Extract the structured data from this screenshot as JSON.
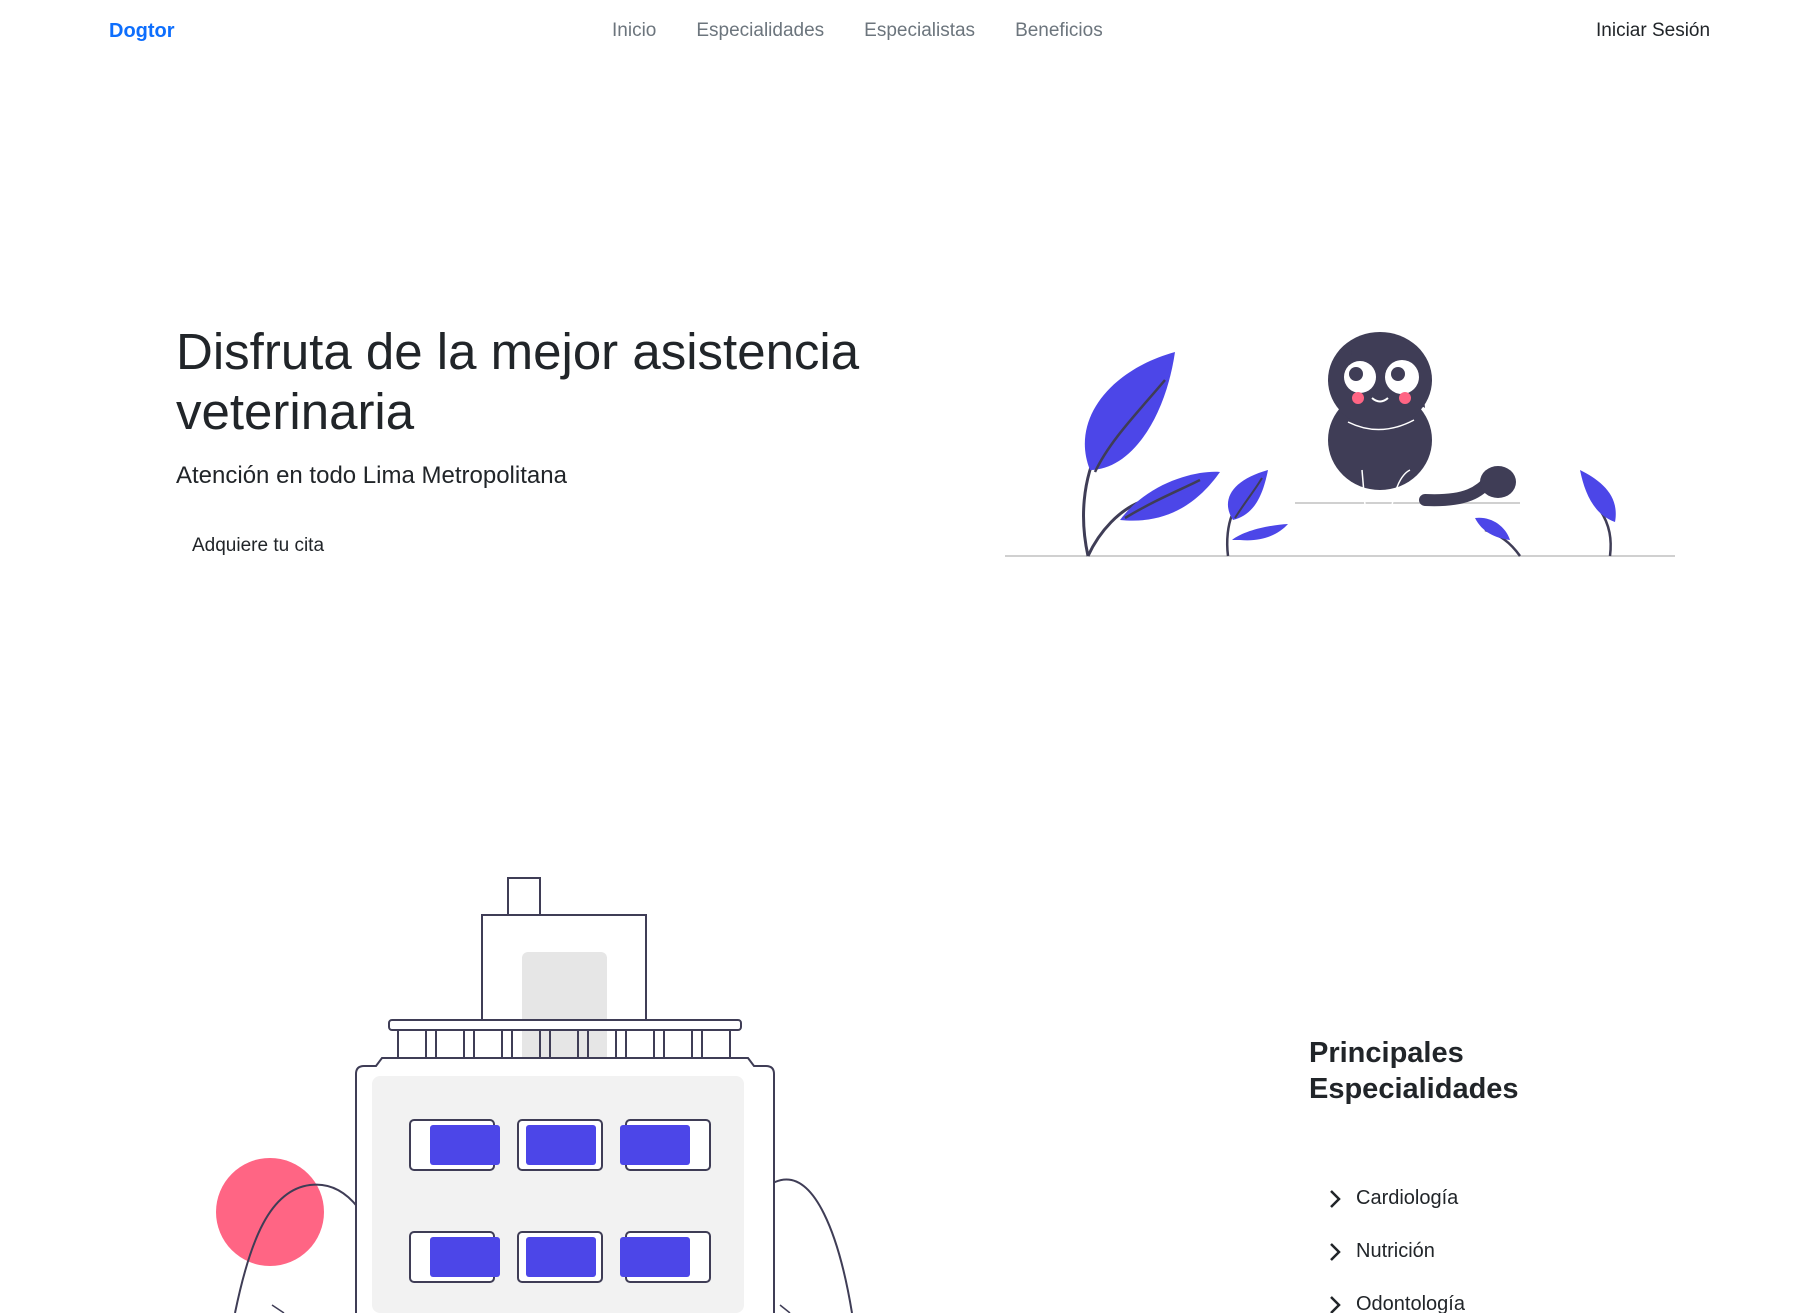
{
  "navbar": {
    "brand": "Dogtor",
    "links": [
      "Inicio",
      "Especialidades",
      "Especialistas",
      "Beneficios"
    ],
    "login": "Iniciar Sesión"
  },
  "hero": {
    "title": "Disfruta de la mejor asistencia veterinaria",
    "subtitle": "Atención en todo Lima Metropolitana",
    "cta": "Adquiere tu cita"
  },
  "specialties": {
    "title": "Principales Especialidades",
    "items": [
      "Cardiología",
      "Nutrición",
      "Odontología"
    ]
  },
  "colors": {
    "brand": "#0d6efd",
    "illustration_primary": "#4c46e8",
    "illustration_dark": "#3f3d56",
    "illustration_accent": "#ff6584"
  }
}
